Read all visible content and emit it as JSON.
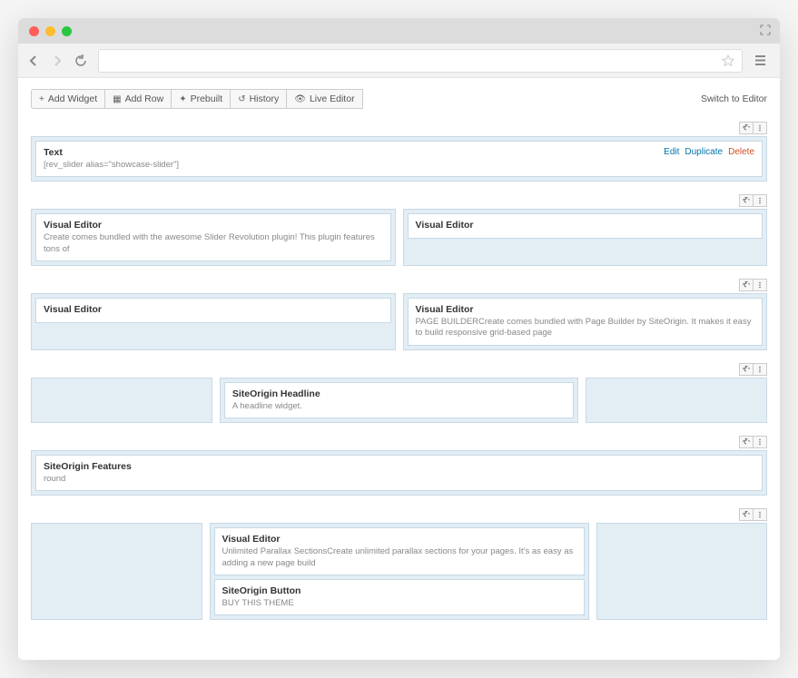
{
  "toolbar": {
    "add_widget": "Add Widget",
    "add_row": "Add Row",
    "prebuilt": "Prebuilt",
    "history": "History",
    "live_editor": "Live Editor",
    "switch": "Switch to Editor"
  },
  "rows": [
    {
      "cells": [
        {
          "flex": 1,
          "widgets": [
            {
              "title": "Text",
              "sub": "[rev_slider alias=\"showcase-slider\"]",
              "actions": true
            }
          ]
        }
      ]
    },
    {
      "cells": [
        {
          "flex": 1,
          "widgets": [
            {
              "title": "Visual Editor",
              "sub": "Create comes bundled with the awesome Slider Revolution plugin! This plugin features tons of"
            }
          ]
        },
        {
          "flex": 1,
          "widgets": [
            {
              "title": "Visual Editor",
              "sub": ""
            }
          ]
        }
      ]
    },
    {
      "cells": [
        {
          "flex": 1,
          "widgets": [
            {
              "title": "Visual Editor",
              "sub": ""
            }
          ]
        },
        {
          "flex": 1,
          "widgets": [
            {
              "title": "Visual Editor",
              "sub": "PAGE BUILDERCreate comes bundled with Page Builder by SiteOrigin. It makes it easy to build responsive grid-based page"
            }
          ]
        }
      ]
    },
    {
      "cells": [
        {
          "flex": 0.33,
          "widgets": []
        },
        {
          "flex": 0.67,
          "widgets": [
            {
              "title": "SiteOrigin Headline",
              "sub": "A headline widget."
            }
          ]
        },
        {
          "flex": 0.33,
          "widgets": []
        }
      ]
    },
    {
      "cells": [
        {
          "flex": 1,
          "widgets": [
            {
              "title": "SiteOrigin Features",
              "sub": "round"
            }
          ]
        }
      ]
    },
    {
      "cells": [
        {
          "flex": 0.28,
          "widgets": []
        },
        {
          "flex": 0.64,
          "widgets": [
            {
              "title": "Visual Editor",
              "sub": "Unlimited Parallax SectionsCreate unlimited parallax sections for your pages. It's as easy as adding a new page build"
            },
            {
              "title": "SiteOrigin Button",
              "sub": "BUY THIS THEME"
            }
          ]
        },
        {
          "flex": 0.28,
          "widgets": []
        }
      ]
    }
  ],
  "widget_actions": {
    "edit": "Edit",
    "duplicate": "Duplicate",
    "delete": "Delete"
  }
}
